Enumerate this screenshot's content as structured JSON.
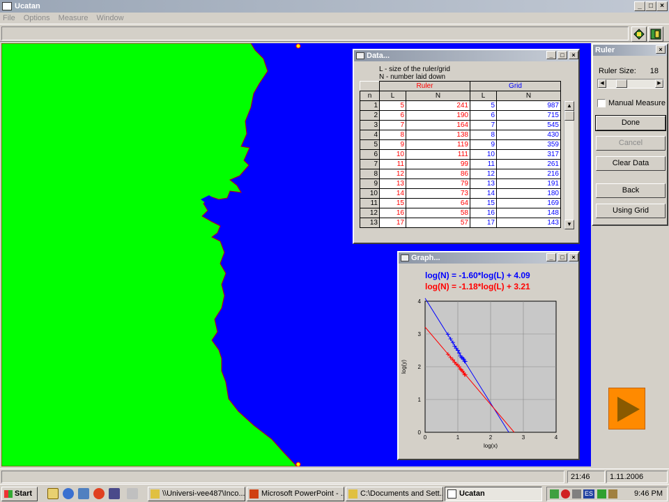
{
  "window": {
    "title": "Ucatan",
    "minimize": "_",
    "maximize": "□",
    "close": "×"
  },
  "menu": [
    "File",
    "Options",
    "Measure",
    "Window"
  ],
  "data_window": {
    "title": "Data...",
    "notes": [
      "L - size of the ruler/grid",
      "N - number laid down"
    ],
    "group_headers": {
      "ruler": "Ruler",
      "grid": "Grid"
    },
    "columns": [
      "n",
      "L",
      "N",
      "L",
      "N"
    ],
    "rows": [
      [
        "1",
        "5",
        "241",
        "5",
        "987"
      ],
      [
        "2",
        "6",
        "190",
        "6",
        "715"
      ],
      [
        "3",
        "7",
        "164",
        "7",
        "545"
      ],
      [
        "4",
        "8",
        "138",
        "8",
        "430"
      ],
      [
        "5",
        "9",
        "119",
        "9",
        "359"
      ],
      [
        "6",
        "10",
        "111",
        "10",
        "317"
      ],
      [
        "7",
        "11",
        "99",
        "11",
        "261"
      ],
      [
        "8",
        "12",
        "86",
        "12",
        "216"
      ],
      [
        "9",
        "13",
        "79",
        "13",
        "191"
      ],
      [
        "10",
        "14",
        "73",
        "14",
        "180"
      ],
      [
        "11",
        "15",
        "64",
        "15",
        "169"
      ],
      [
        "12",
        "16",
        "58",
        "16",
        "148"
      ],
      [
        "13",
        "17",
        "57",
        "17",
        "143"
      ]
    ]
  },
  "graph_window": {
    "title": "Graph...",
    "eq_blue": "log(N) = -1.60*log(L) + 4.09",
    "eq_red": "log(N) = -1.18*log(L) + 3.21",
    "xlabel": "log(x)",
    "ylabel": "log(y)"
  },
  "chart_data": {
    "type": "scatter",
    "xlabel": "log(x)",
    "ylabel": "log(y)",
    "xlim": [
      0,
      4
    ],
    "ylim": [
      0,
      4
    ],
    "xticks": [
      "0",
      "1",
      "2",
      "3",
      "4"
    ],
    "yticks": [
      "0",
      "1",
      "2",
      "3",
      "4"
    ],
    "grid": true,
    "series": [
      {
        "color": "#0000ff",
        "x": [
          0.7,
          0.78,
          0.85,
          0.9,
          0.95,
          1.0,
          1.04,
          1.08,
          1.11,
          1.15,
          1.18,
          1.2,
          1.23
        ],
        "y": [
          2.99,
          2.85,
          2.74,
          2.63,
          2.56,
          2.5,
          2.42,
          2.33,
          2.28,
          2.26,
          2.23,
          2.17,
          2.16
        ],
        "fit": {
          "slope": -1.6,
          "intercept": 4.09
        }
      },
      {
        "color": "#ff0000",
        "x": [
          0.7,
          0.78,
          0.85,
          0.9,
          0.95,
          1.0,
          1.04,
          1.08,
          1.11,
          1.15,
          1.18,
          1.2,
          1.23
        ],
        "y": [
          2.38,
          2.28,
          2.21,
          2.14,
          2.08,
          2.05,
          2.0,
          1.93,
          1.9,
          1.86,
          1.81,
          1.76,
          1.76
        ],
        "fit": {
          "slope": -1.18,
          "intercept": 3.21
        }
      }
    ]
  },
  "ruler_panel": {
    "title": "Ruler",
    "size_label": "Ruler Size:",
    "size_value": "18",
    "manual_measure": "Manual Measure",
    "buttons": {
      "done": "Done",
      "cancel": "Cancel",
      "clear": "Clear Data",
      "back": "Back",
      "grid": "Using Grid"
    }
  },
  "status": {
    "time": "21:46",
    "date": "1.11.2006"
  },
  "taskbar": {
    "start": "Start",
    "tasks": [
      "\\\\Universi-vee487\\Inco...",
      "Microsoft PowerPoint - ...",
      "C:\\Documents and Sett...",
      "Ucatan"
    ],
    "lang": "ES",
    "clock": "9:46 PM"
  },
  "colors": {
    "map_land": "#00ff00",
    "map_water": "#0000ff",
    "play_button": "#ff8a00"
  }
}
